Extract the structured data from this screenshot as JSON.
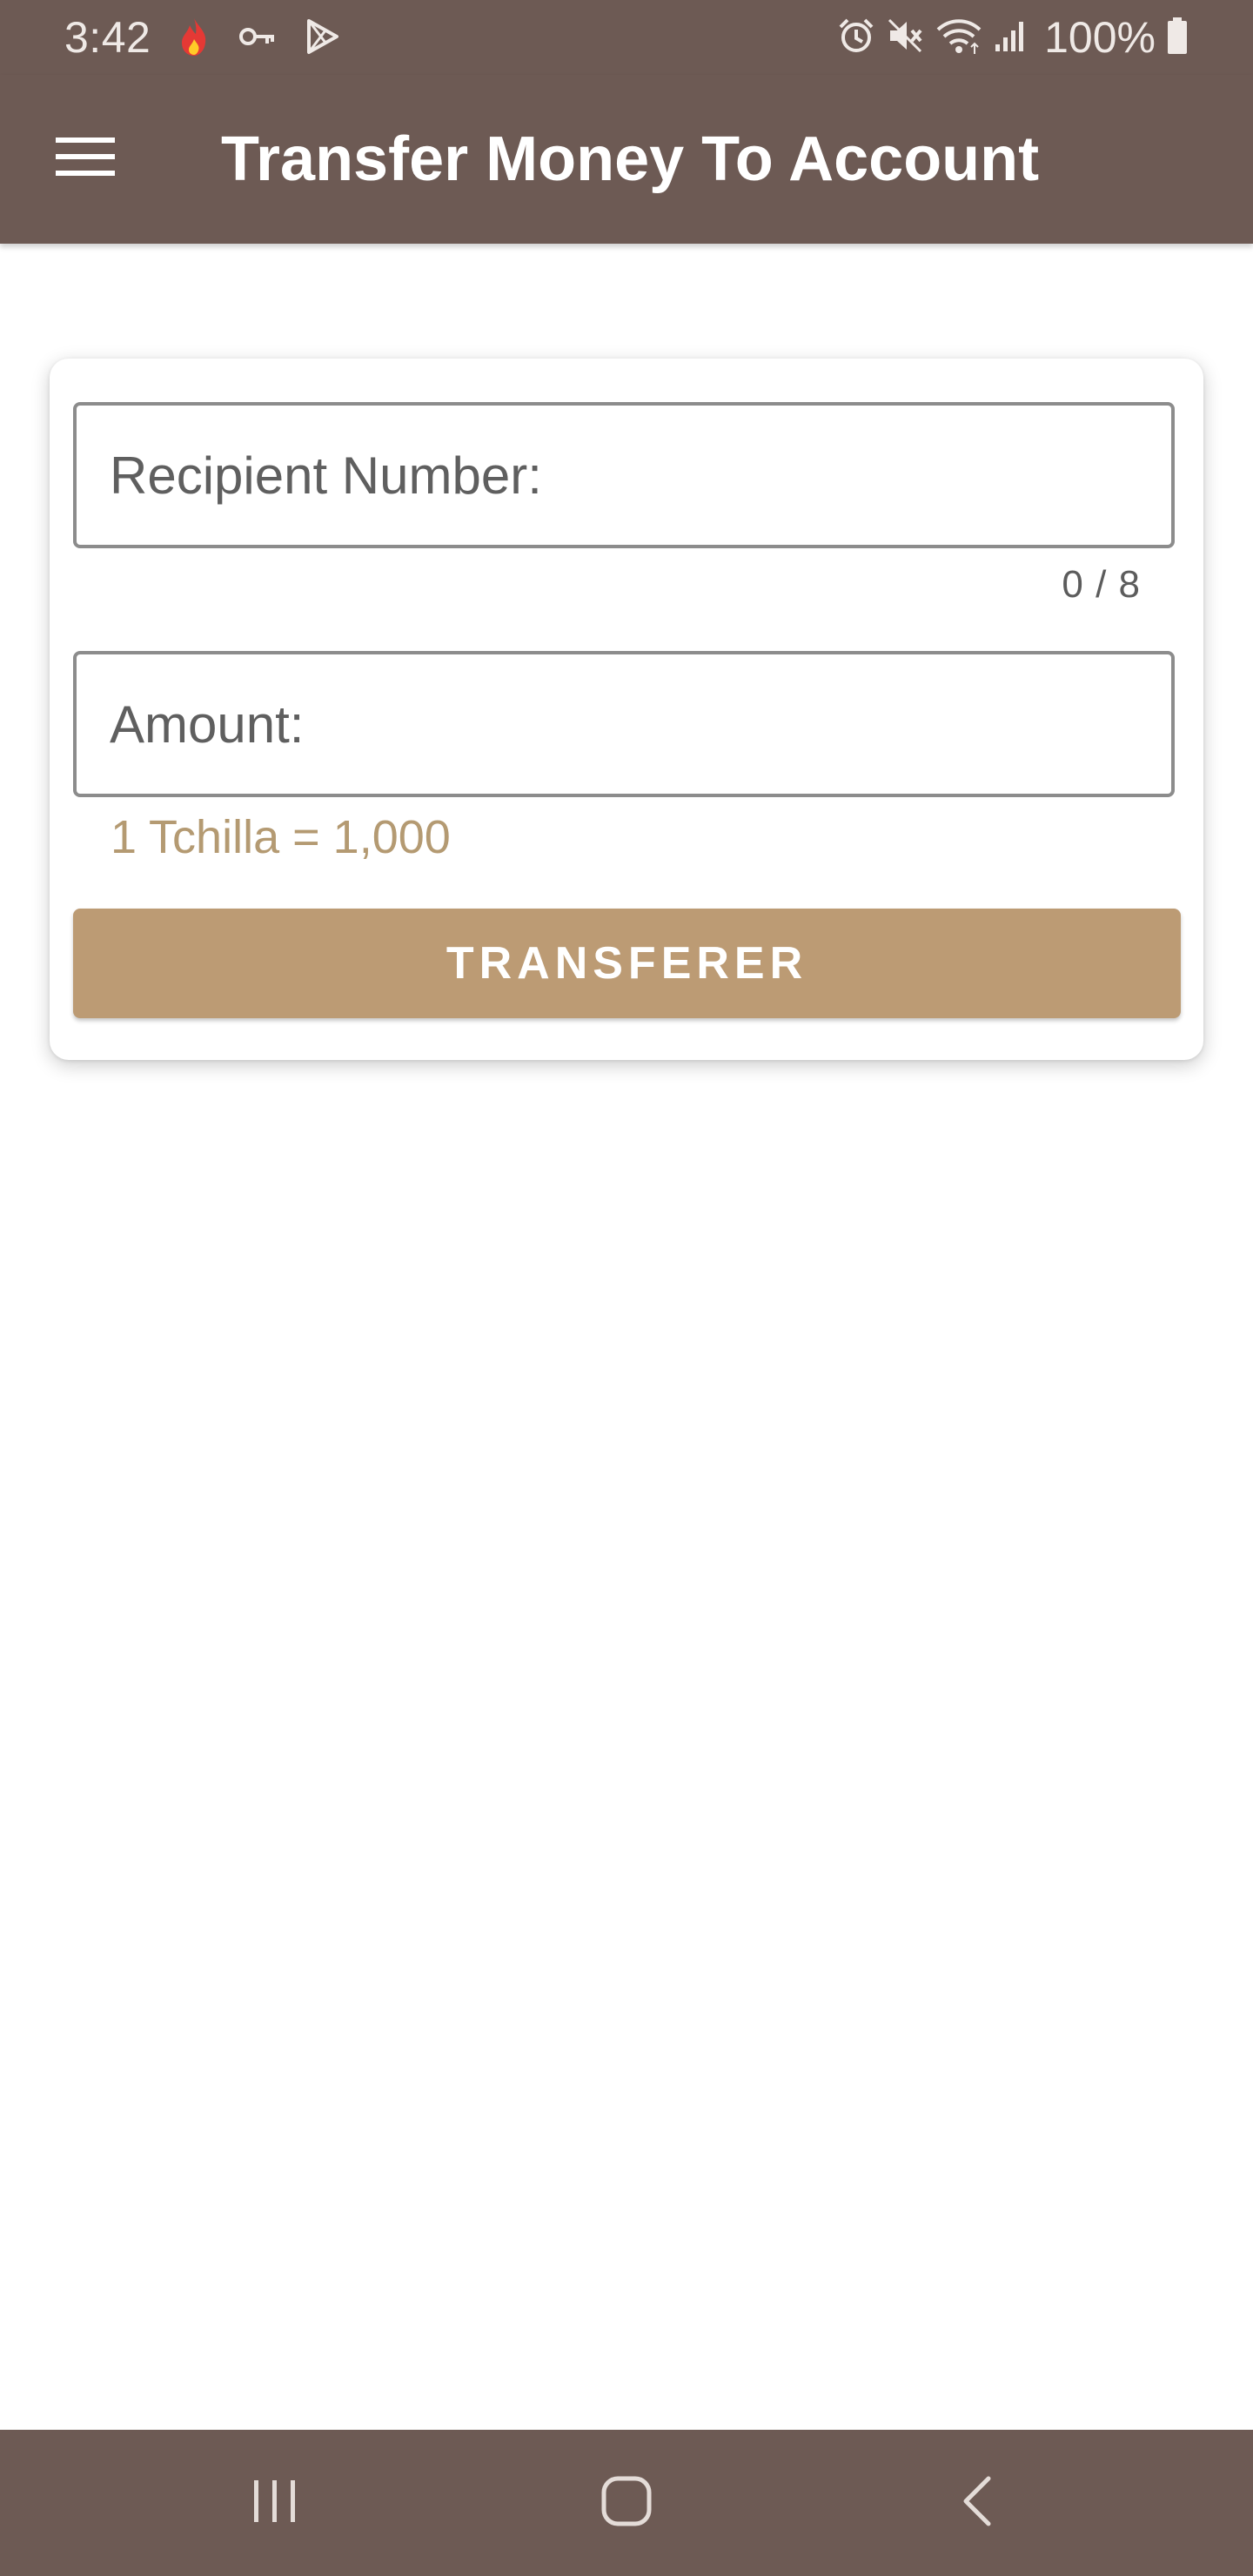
{
  "status_bar": {
    "time": "3:42",
    "battery_text": "100%",
    "left_icons": [
      "fire-icon",
      "key-icon",
      "play-store-icon"
    ],
    "right_icons": [
      "alarm-icon",
      "mute-icon",
      "wifi-icon",
      "signal-icon",
      "battery-icon"
    ]
  },
  "app_bar": {
    "title": "Transfer Money To Account",
    "menu_icon": "menu-icon"
  },
  "form": {
    "recipient": {
      "placeholder": "Recipient Number:",
      "value": "",
      "counter": "0 / 8"
    },
    "amount": {
      "placeholder": "Amount:",
      "value": "",
      "helper": "1 Tchilla = 1,000"
    },
    "submit_label": "TRANSFERER"
  },
  "nav_bar": {
    "items": [
      "recent-apps-icon",
      "home-icon",
      "back-icon"
    ]
  },
  "colors": {
    "primary": "#6d5a54",
    "accent": "#bc9b74",
    "helper_text": "#b49a72",
    "background": "#ffffff"
  }
}
